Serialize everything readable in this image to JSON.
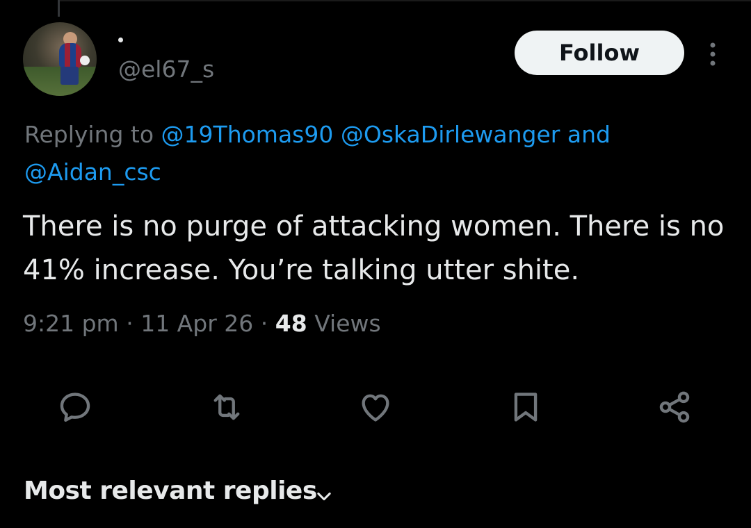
{
  "author": {
    "display_name": "·",
    "handle": "@el67_s"
  },
  "follow_button": {
    "label": "Follow"
  },
  "replying": {
    "prefix": "Replying to ",
    "mentions": [
      "@19Thomas90",
      "@OskaDirlewanger",
      "@Aidan_csc"
    ],
    "and_word": "and"
  },
  "tweet": {
    "text": "There is no purge of attacking women. There is no 41% increase. You’re talking utter shite.",
    "time": "9:21 pm",
    "separator": "·",
    "date": "11 Apr 26",
    "views_count": "48",
    "views_label": "Views"
  },
  "actions": [
    {
      "name": "reply",
      "icon": "reply-icon"
    },
    {
      "name": "retweet",
      "icon": "retweet-icon"
    },
    {
      "name": "like",
      "icon": "heart-icon"
    },
    {
      "name": "bookmark",
      "icon": "bookmark-icon"
    },
    {
      "name": "share",
      "icon": "share-icon"
    }
  ],
  "replies_header": {
    "label": "Most relevant replies",
    "icon": "chevron-down-icon"
  },
  "colors": {
    "background": "#000000",
    "text": "#e7e9ea",
    "secondary": "#71767b",
    "link": "#1d9bf0",
    "follow_bg": "#eff3f4"
  }
}
